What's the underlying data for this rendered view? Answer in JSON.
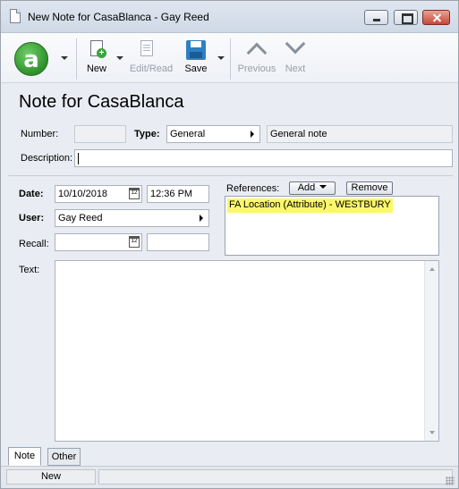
{
  "window": {
    "title": "New Note for CasaBlanca - Gay Reed"
  },
  "toolbar": {
    "logo_letter": "a",
    "new_label": "New",
    "edit_read_label": "Edit/Read",
    "save_label": "Save",
    "previous_label": "Previous",
    "next_label": "Next"
  },
  "page": {
    "title": "Note for CasaBlanca"
  },
  "form": {
    "number_label": "Number:",
    "number_value": "",
    "type_label": "Type:",
    "type_value": "General",
    "type_description": "General note",
    "description_label": "Description:",
    "description_value": "",
    "date_label": "Date:",
    "date_value": "10/10/2018",
    "time_value": "12:36 PM",
    "user_label": "User:",
    "user_value": "Gay Reed",
    "recall_label": "Recall:",
    "recall_date_value": "",
    "recall_time_value": "",
    "text_label": "Text:",
    "text_value": ""
  },
  "references": {
    "label": "References:",
    "add_label": "Add",
    "remove_label": "Remove",
    "items": [
      "FA Location (Attribute) - WESTBURY"
    ]
  },
  "tabs": [
    {
      "label": "Note",
      "active": true
    },
    {
      "label": "Other",
      "active": false
    }
  ],
  "status": {
    "mode": "New",
    "message": ""
  },
  "icons": {
    "calendar_glyph": "12"
  }
}
